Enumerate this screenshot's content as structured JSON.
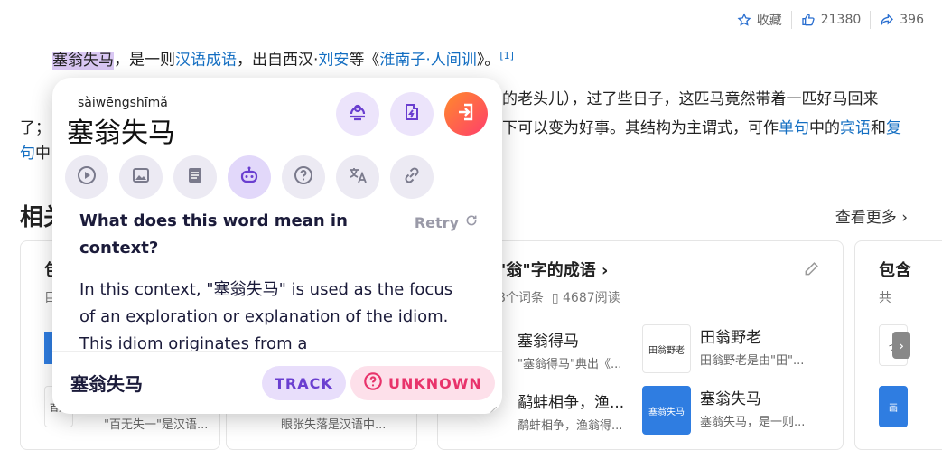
{
  "topbar": {
    "collect_label": "收藏",
    "like_count": "21380",
    "share_count": "396"
  },
  "article": {
    "line1": {
      "highlight": "塞翁失马",
      "t1": "，是一则",
      "link1": "汉语成语",
      "t2": "，出自西汉·",
      "link2": "刘安",
      "t3": "等《",
      "link3": "淮南子·人间训",
      "t4": "》。",
      "sup": "[1]"
    },
    "line2_right": "的老头儿），过了些日子，这匹马竟然带着一匹好马回来",
    "line3_left": "了；",
    "line3_right_a": "下可以变为好事。其结构为主谓式，可作",
    "line3_link1": "单句",
    "line3_t2": "中的",
    "line3_link2": "宾语",
    "line3_t3": "和",
    "line3_link3": "复",
    "line4_link": "句",
    "line4_t": "中"
  },
  "related": {
    "title_partial": "相关",
    "more_label": "查看更多",
    "card_left": {
      "title_partial": "包",
      "meta_partial": "目",
      "item_thumb": "百无",
      "item_desc": "\"百无失一\"是汉语..."
    },
    "card_mid": {
      "title": "\"翁\"字的成语",
      "count": "8个词条",
      "reads": "4687阅读",
      "left_item_desc": "眼张失落是汉语中...",
      "items": [
        {
          "title": "塞翁得马",
          "desc": "\"塞翁得马\"典出《..."
        },
        {
          "title": "田翁野老",
          "desc": "田翁野老是由\"田\"...",
          "thumb": "田翁野老"
        },
        {
          "title": "鹬蚌相争，渔...",
          "desc": "鹬蚌相争，渔翁得..."
        },
        {
          "title": "塞翁失马",
          "desc": "塞翁失马，是一则...",
          "thumb": "塞翁失马"
        }
      ]
    },
    "card_right": {
      "title_partial": "包含",
      "meta_partial": "共",
      "thumb_a": "也",
      "thumb_b": "画"
    }
  },
  "popup": {
    "pinyin": "sàiwēngshīmǎ",
    "word": "塞翁失马",
    "question": "What does this word mean in context?",
    "retry_label": "Retry",
    "answer": "In this context, \"塞翁失马\" is used as the focus of an exploration or explanation of the idiom. This idiom originates from a",
    "footer_word": "塞翁失马",
    "track_label": "TRACK",
    "unknown_label": "UNKNOWN",
    "accent_purple": "#6a3fd0",
    "accent_pink": "#e8336b"
  }
}
